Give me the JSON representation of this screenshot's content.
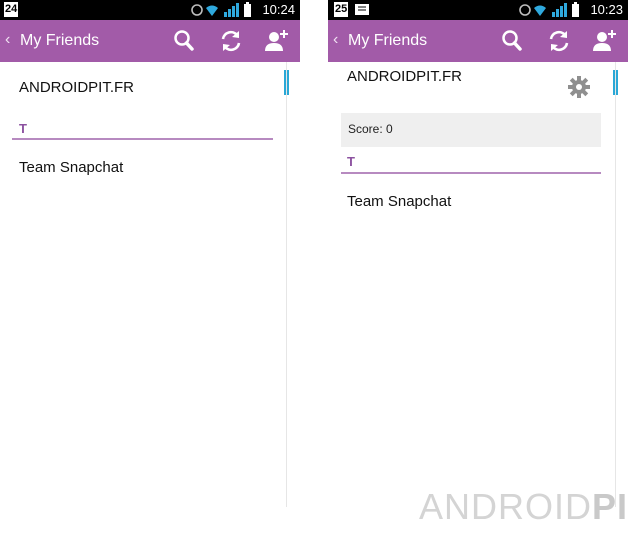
{
  "left_screen": {
    "status": {
      "notification": "24",
      "time": "10:24"
    },
    "action_bar": {
      "title": "My Friends"
    },
    "friends": [
      {
        "name": "ANDROIDPIT.FR"
      }
    ],
    "section_letter": "T",
    "section_friends": [
      {
        "name": "Team Snapchat"
      }
    ]
  },
  "right_screen": {
    "status": {
      "notification": "25",
      "time": "10:23"
    },
    "action_bar": {
      "title": "My Friends"
    },
    "friends": [
      {
        "name": "ANDROIDPIT.FR"
      }
    ],
    "score_label": "Score: 0",
    "section_letter": "T",
    "section_friends": [
      {
        "name": "Team Snapchat"
      }
    ]
  },
  "watermark": {
    "part1": "ANDROID",
    "part2": "PIT"
  },
  "icons": [
    "back-chevron-icon",
    "search-icon",
    "refresh-icon",
    "add-friend-icon",
    "wifi-icon",
    "signal-icon",
    "gear-icon"
  ],
  "colors": {
    "action_bar": "#a25ba8",
    "section_accent": "#8c52a0",
    "scroll_indicator": "#2aa8d6",
    "score_background": "#efefef"
  }
}
